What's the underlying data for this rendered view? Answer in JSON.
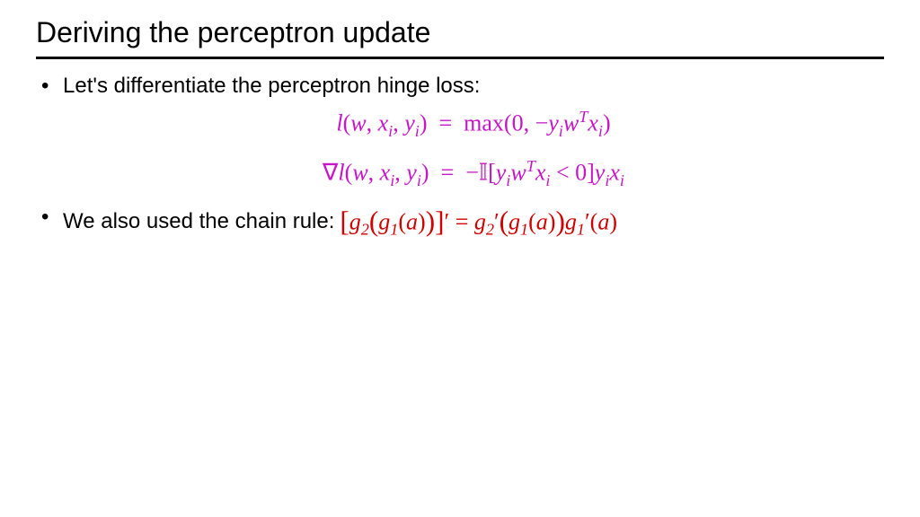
{
  "slide": {
    "title": "Deriving the perceptron update",
    "bullet1": "Let's differentiate the perceptron hinge loss:",
    "eq1": "𝑙(𝑤, 𝑥ᵢ, 𝑦ᵢ) = max(0, −𝑦ᵢ𝑤ᵀ𝑥ᵢ)",
    "eq2": "∇𝑙(𝑤, 𝑥ᵢ, 𝑦ᵢ) = −𝕀[𝑦ᵢ𝑤ᵀ𝑥ᵢ < 0]𝑦ᵢ𝑥ᵢ",
    "bullet2_prefix": "We also used the chain rule: ",
    "eq3": "[𝑔₂(𝑔₁(𝑎))]′ = 𝑔₂′(𝑔₁(𝑎))𝑔₁′(𝑎)"
  },
  "colors": {
    "math_purple": "#c815c8",
    "math_red": "#d00000"
  }
}
